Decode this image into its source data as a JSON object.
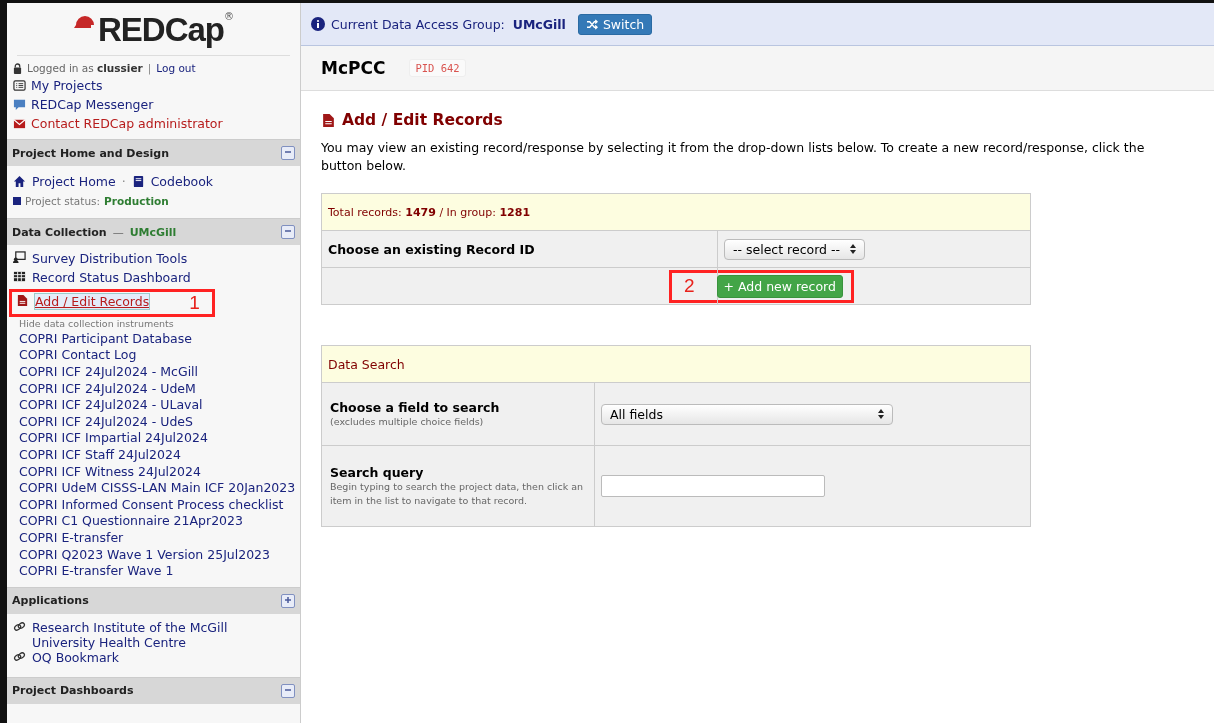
{
  "logo": {
    "text": "REDCap",
    "mark": "®"
  },
  "login": {
    "prefix": "Logged in as",
    "user": "clussier",
    "separator": "|",
    "logout": "Log out"
  },
  "top_links": [
    {
      "kind": "list",
      "label": "My Projects"
    },
    {
      "kind": "chat",
      "label": "REDCap Messenger"
    },
    {
      "kind": "mail",
      "label": "Contact REDCap administrator"
    }
  ],
  "sections": [
    {
      "title": "Project Home and Design",
      "expanded": true,
      "rows": [
        {
          "kind": "links",
          "separator": "·",
          "links": [
            {
              "kind": "home",
              "label": "Project Home"
            },
            {
              "kind": "book",
              "label": "Codebook"
            }
          ]
        },
        {
          "kind": "status",
          "label": "Project status:",
          "value": "Production"
        }
      ]
    },
    {
      "title": "Data Collection",
      "dash": "—",
      "group": "UMcGill",
      "expanded": true,
      "rows": [
        {
          "kind": "survey",
          "label": "Survey Distribution Tools",
          "selected": false
        },
        {
          "kind": "grid",
          "label": "Record Status Dashboard",
          "selected": false
        },
        {
          "kind": "file",
          "label": "Add / Edit Records",
          "selected": true,
          "annotation": "1"
        },
        {
          "kind": "note",
          "label": "Hide data collection instruments"
        },
        {
          "kind": "instrument",
          "label": "COPRI Participant Database"
        },
        {
          "kind": "instrument",
          "label": "COPRI Contact Log"
        },
        {
          "kind": "instrument",
          "label": "COPRI ICF 24Jul2024 - McGill"
        },
        {
          "kind": "instrument",
          "label": "COPRI ICF 24Jul2024 - UdeM"
        },
        {
          "kind": "instrument",
          "label": "COPRI ICF 24Jul2024 - ULaval"
        },
        {
          "kind": "instrument",
          "label": "COPRI ICF 24Jul2024 - UdeS"
        },
        {
          "kind": "instrument",
          "label": "COPRI ICF Impartial 24Jul2024"
        },
        {
          "kind": "instrument",
          "label": "COPRI ICF Staff 24Jul2024"
        },
        {
          "kind": "instrument",
          "label": "COPRI ICF Witness 24Jul2024"
        },
        {
          "kind": "instrument",
          "label": "COPRI UdeM CISSS-LAN Main ICF 20Jan2023"
        },
        {
          "kind": "instrument",
          "label": "COPRI Informed Consent Process checklist"
        },
        {
          "kind": "instrument",
          "label": "COPRI C1 Questionnaire 21Apr2023"
        },
        {
          "kind": "instrument",
          "label": "COPRI E-transfer"
        },
        {
          "kind": "instrument",
          "label": "COPRI Q2023 Wave 1 Version 25Jul2023"
        },
        {
          "kind": "instrument",
          "label": "COPRI E-transfer Wave 1"
        }
      ]
    },
    {
      "title": "Applications",
      "expanded": false,
      "rows": [
        {
          "kind": "chain",
          "label": "Research Institute of the McGill University Health Centre",
          "selected": false
        },
        {
          "kind": "chain",
          "label": "OQ Bookmark",
          "selected": false
        }
      ]
    },
    {
      "title": "Project Dashboards",
      "expanded": true
    }
  ],
  "banner": {
    "label": "Current Data Access Group:",
    "group": "UMcGill",
    "button": "Switch"
  },
  "project": {
    "name": "McPCC",
    "pid": "PID 642"
  },
  "page": {
    "title": "Add / Edit Records",
    "description": "You may view an existing record/response by selecting it from the drop-down lists below. To create a new record/response, click the button below."
  },
  "records_panel": {
    "summary": "Total records: **1479**  /  In group: **1281**",
    "choose_label": "Choose an existing Record ID",
    "select_value": "-- select record --",
    "add_button": "+ Add new record",
    "annotation": "2"
  },
  "search_panel": {
    "title": "Data Search",
    "rows": [
      {
        "kind": "select",
        "label": "Choose a field to search",
        "note": "(excludes multiple choice fields)",
        "value": "All fields"
      },
      {
        "kind": "text",
        "label": "Search query",
        "note": "Begin typing to search the project data, then click an item in the list to navigate to that record."
      }
    ]
  }
}
